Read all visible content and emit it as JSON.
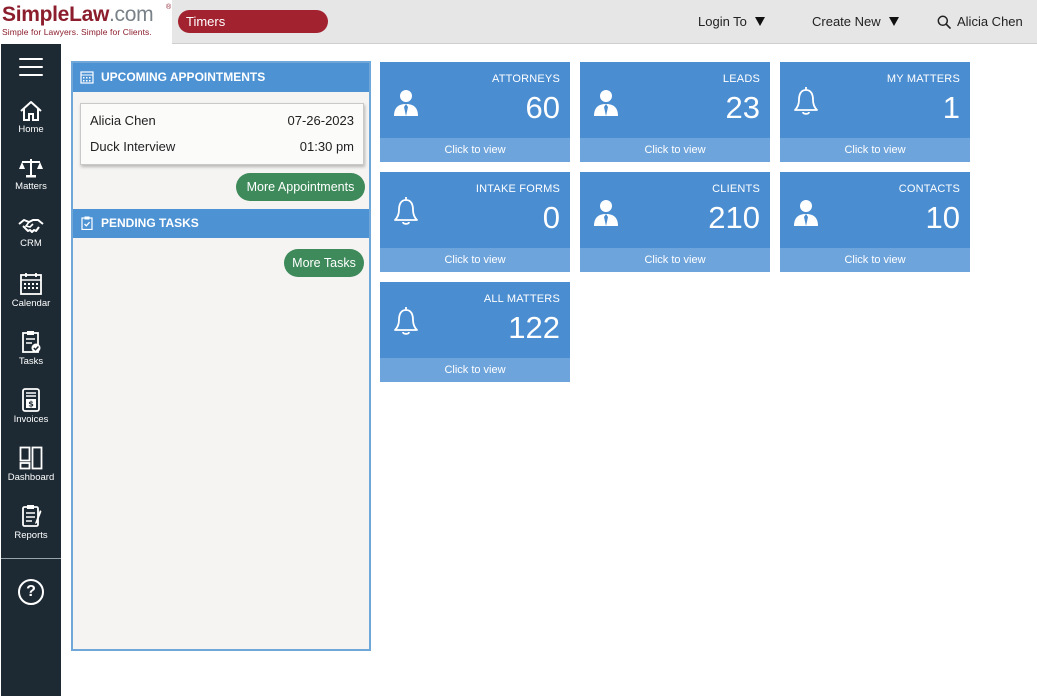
{
  "brand": {
    "name_part1": "Simple",
    "name_part2": "Law",
    "name_part3": ".com",
    "registered": "®",
    "tagline": "Simple for Lawyers. Simple for Clients.",
    "color": "#8b1d2c"
  },
  "topbar": {
    "timers_label": "Timers",
    "login_label": "Login To",
    "create_label": "Create New",
    "user_name": "Alicia Chen",
    "timers_color": "#a3222f"
  },
  "sidebar": {
    "items": [
      {
        "label": "Home",
        "icon": "home-icon"
      },
      {
        "label": "Matters",
        "icon": "scales-icon"
      },
      {
        "label": "CRM",
        "icon": "handshake-icon"
      },
      {
        "label": "Calendar",
        "icon": "calendar-icon"
      },
      {
        "label": "Tasks",
        "icon": "clipboard-check-icon"
      },
      {
        "label": "Invoices",
        "icon": "invoice-icon"
      },
      {
        "label": "Dashboard",
        "icon": "dashboard-icon"
      },
      {
        "label": "Reports",
        "icon": "report-icon"
      }
    ],
    "help_label": "?"
  },
  "appointments": {
    "heading": "UPCOMING APPOINTMENTS",
    "items": [
      {
        "name": "Alicia Chen",
        "date": "07-26-2023",
        "title": "Duck Interview",
        "time": "01:30 pm"
      }
    ],
    "more_label": "More Appointments"
  },
  "tasks": {
    "heading": "PENDING TASKS",
    "more_label": "More Tasks"
  },
  "tiles": [
    {
      "title": "ATTORNEYS",
      "value": "60",
      "footer": "Click to view",
      "icon": "person-icon"
    },
    {
      "title": "LEADS",
      "value": "23",
      "footer": "Click to view",
      "icon": "person-icon"
    },
    {
      "title": "MY MATTERS",
      "value": "1",
      "footer": "Click to view",
      "icon": "bell-icon"
    },
    {
      "title": "INTAKE FORMS",
      "value": "0",
      "footer": "Click to view",
      "icon": "bell-icon"
    },
    {
      "title": "CLIENTS",
      "value": "210",
      "footer": "Click to view",
      "icon": "person-icon"
    },
    {
      "title": "CONTACTS",
      "value": "10",
      "footer": "Click to view",
      "icon": "person-icon"
    },
    {
      "title": "ALL MATTERS",
      "value": "122",
      "footer": "Click to view",
      "icon": "bell-icon"
    }
  ],
  "colors": {
    "sidebar_bg": "#1d2a33",
    "tile_bg": "#4a8dd1",
    "tile_footer": "#6ea4dc",
    "panel_header": "#4d93d4",
    "button_green": "#3e8a5a"
  }
}
